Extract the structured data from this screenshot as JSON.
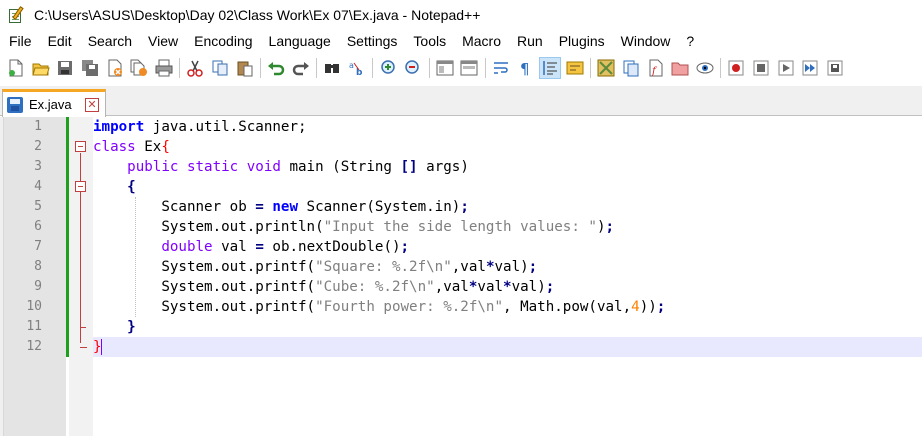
{
  "window": {
    "title": "C:\\Users\\ASUS\\Desktop\\Day 02\\Class Work\\Ex 07\\Ex.java - Notepad++"
  },
  "menu": [
    "File",
    "Edit",
    "Search",
    "View",
    "Encoding",
    "Language",
    "Settings",
    "Tools",
    "Macro",
    "Run",
    "Plugins",
    "Window",
    "?"
  ],
  "toolbar": {
    "icons": [
      "new-file-icon",
      "open-file-icon",
      "save-icon",
      "save-all-icon",
      "close-icon",
      "close-all-icon",
      "print-icon",
      "cut-icon",
      "copy-icon",
      "paste-icon",
      "undo-icon",
      "redo-icon",
      "find-icon",
      "replace-icon",
      "zoom-in-icon",
      "zoom-out-icon",
      "sync-vertical-icon",
      "sync-horizontal-icon",
      "word-wrap-icon",
      "show-all-chars-icon",
      "indent-guide-icon",
      "user-language-icon",
      "document-map-icon",
      "function-list-icon",
      "folder-workspace-icon",
      "monitoring-icon",
      "record-macro-icon",
      "stop-record-icon",
      "playback-macro-icon",
      "run-macro-multiple-icon",
      "save-macro-icon"
    ],
    "active": "indent-guide-icon"
  },
  "tabs": [
    {
      "label": "Ex.java",
      "close": "✕"
    }
  ],
  "editor": {
    "line_numbers": [
      "1",
      "2",
      "3",
      "4",
      "5",
      "6",
      "7",
      "8",
      "9",
      "10",
      "11",
      "12"
    ],
    "current_line": 12,
    "lines": [
      [
        {
          "t": "import",
          "c": "kw"
        },
        {
          "t": " java.util.Scanner;",
          "c": ""
        }
      ],
      [
        {
          "t": "class",
          "c": "kw2"
        },
        {
          "t": " Ex",
          "c": ""
        },
        {
          "t": "{",
          "c": "br"
        }
      ],
      [
        {
          "t": "    ",
          "c": ""
        },
        {
          "t": "public static void",
          "c": "kw2"
        },
        {
          "t": " main (String ",
          "c": ""
        },
        {
          "t": "[]",
          "c": "op"
        },
        {
          "t": " args)",
          "c": ""
        }
      ],
      [
        {
          "t": "    ",
          "c": ""
        },
        {
          "t": "{",
          "c": "op"
        }
      ],
      [
        {
          "t": "        Scanner ob ",
          "c": ""
        },
        {
          "t": "=",
          "c": "op"
        },
        {
          "t": " ",
          "c": ""
        },
        {
          "t": "new",
          "c": "kw"
        },
        {
          "t": " Scanner(System.in)",
          "c": ""
        },
        {
          "t": ";",
          "c": "op"
        }
      ],
      [
        {
          "t": "        System.out.println(",
          "c": ""
        },
        {
          "t": "\"Input the side length values: \"",
          "c": "str"
        },
        {
          "t": ")",
          "c": ""
        },
        {
          "t": ";",
          "c": "op"
        }
      ],
      [
        {
          "t": "        ",
          "c": ""
        },
        {
          "t": "double",
          "c": "kw2"
        },
        {
          "t": " val ",
          "c": ""
        },
        {
          "t": "=",
          "c": "op"
        },
        {
          "t": " ob.nextDouble()",
          "c": ""
        },
        {
          "t": ";",
          "c": "op"
        }
      ],
      [
        {
          "t": "        System.out.printf(",
          "c": ""
        },
        {
          "t": "\"Square: %.2f\\n\"",
          "c": "str"
        },
        {
          "t": ",val",
          "c": ""
        },
        {
          "t": "*",
          "c": "op"
        },
        {
          "t": "val)",
          "c": ""
        },
        {
          "t": ";",
          "c": "op"
        }
      ],
      [
        {
          "t": "        System.out.printf(",
          "c": ""
        },
        {
          "t": "\"Cube: %.2f\\n\"",
          "c": "str"
        },
        {
          "t": ",val",
          "c": ""
        },
        {
          "t": "*",
          "c": "op"
        },
        {
          "t": "val",
          "c": ""
        },
        {
          "t": "*",
          "c": "op"
        },
        {
          "t": "val)",
          "c": ""
        },
        {
          "t": ";",
          "c": "op"
        }
      ],
      [
        {
          "t": "        System.out.printf(",
          "c": ""
        },
        {
          "t": "\"Fourth power: %.2f\\n\"",
          "c": "str"
        },
        {
          "t": ", Math.pow(val,",
          "c": ""
        },
        {
          "t": "4",
          "c": "num"
        },
        {
          "t": "))",
          "c": ""
        },
        {
          "t": ";",
          "c": "op"
        }
      ],
      [
        {
          "t": "    ",
          "c": ""
        },
        {
          "t": "}",
          "c": "op"
        }
      ],
      [
        {
          "t": "}",
          "c": "br"
        }
      ]
    ]
  }
}
